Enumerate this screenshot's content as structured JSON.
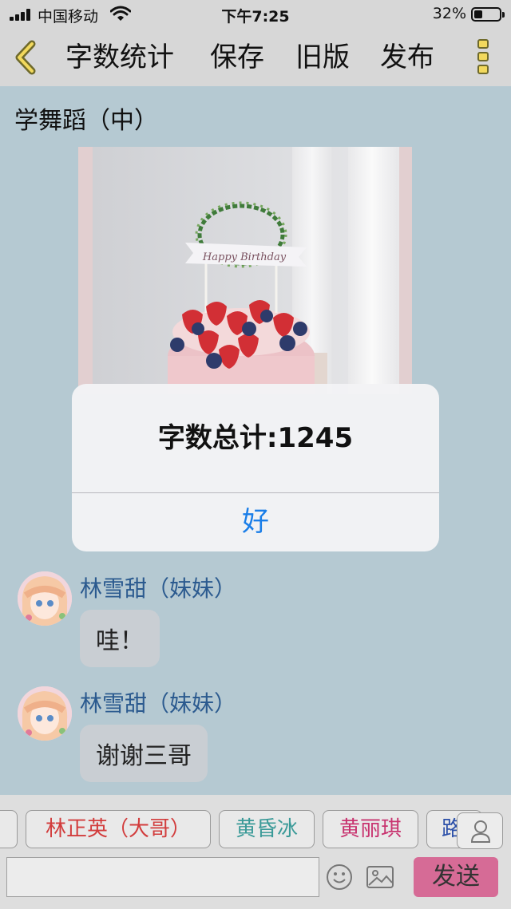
{
  "status_bar": {
    "carrier": "中国移动",
    "time": "下午7:25",
    "battery": "32%",
    "battery_level": 0.32
  },
  "nav": {
    "items": [
      "字数统计",
      "保存",
      "旧版",
      "发布"
    ]
  },
  "post": {
    "title": "学舞蹈（中）",
    "photo_text": "Happy Birthday"
  },
  "messages": [
    {
      "sender": "林雪甜（妹妹）",
      "text": "哇！"
    },
    {
      "sender": "林雪甜（妹妹）",
      "text": "谢谢三哥"
    }
  ],
  "tags": [
    {
      "label": "林正英（大哥）",
      "color": "#d23c3c"
    },
    {
      "label": "黄昏冰",
      "color": "#3a9a98"
    },
    {
      "label": "黄丽琪",
      "color": "#c8336f"
    },
    {
      "label": "路",
      "color": "#2b4fa8"
    }
  ],
  "input": {
    "placeholder": "",
    "send_label": "发送"
  },
  "alert": {
    "message": "字数总计:1245",
    "ok_label": "好"
  },
  "colors": {
    "accent_blue": "#1a7ee8",
    "send_button": "#d66b96",
    "background": "#b5c9d2",
    "sender_name": "#2b5a8f"
  }
}
